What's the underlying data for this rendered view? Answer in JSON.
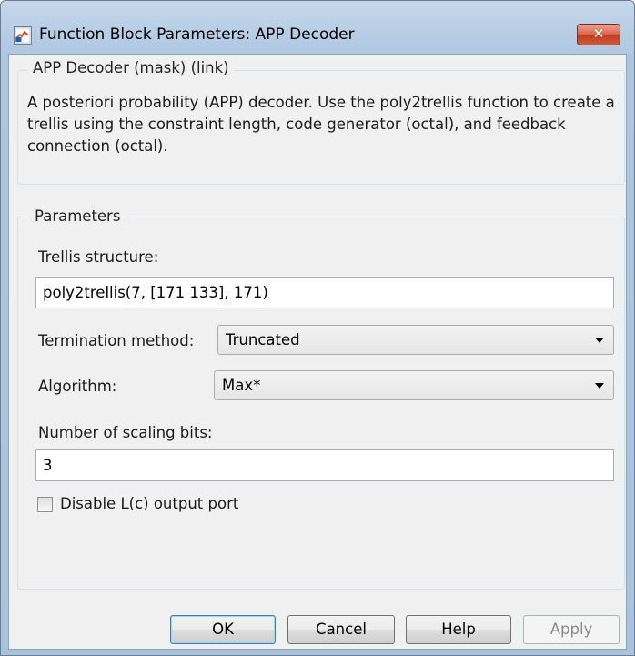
{
  "window": {
    "title": "Function Block Parameters: APP Decoder",
    "close_label": "✕",
    "icon": "simulink-block-icon"
  },
  "description_group": {
    "legend": "APP Decoder (mask) (link)",
    "text": "A posteriori probability (APP) decoder. Use the poly2trellis function to create a trellis using the constraint length, code generator (octal), and feedback connection (octal)."
  },
  "parameters": {
    "legend": "Parameters",
    "trellis_label": "Trellis structure:",
    "trellis_value": "poly2trellis(7, [171 133], 171)",
    "termination_label": "Termination method:",
    "termination_value": "Truncated",
    "algorithm_label": "Algorithm:",
    "algorithm_value": "Max*",
    "scaling_label": "Number of scaling bits:",
    "scaling_value": "3",
    "disable_lc_label": "Disable L(c) output port",
    "disable_lc_checked": false
  },
  "buttons": {
    "ok": "OK",
    "cancel": "Cancel",
    "help": "Help",
    "apply": "Apply"
  }
}
